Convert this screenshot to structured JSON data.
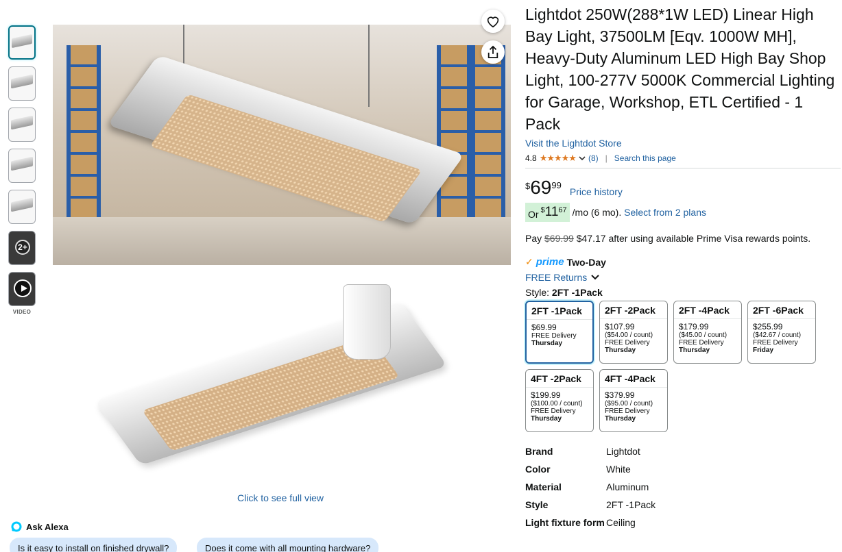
{
  "thumbnails": [
    {
      "kind": "photo",
      "active": true
    },
    {
      "kind": "photo"
    },
    {
      "kind": "photo"
    },
    {
      "kind": "photo"
    },
    {
      "kind": "photo"
    },
    {
      "kind": "more",
      "badge": "2+"
    },
    {
      "kind": "video"
    }
  ],
  "video_label": "VIDEO",
  "image_actions": {
    "wishlist_icon": "heart-icon",
    "share_icon": "share-icon"
  },
  "full_view_link": "Click to see full view",
  "ask_alexa": {
    "label": "Ask Alexa",
    "questions": [
      "Is it easy to install on finished drywall?",
      "Does it come with all mounting hardware?"
    ]
  },
  "product": {
    "title": "Lightdot 250W(288*1W LED) Linear High Bay Light, 37500LM [Eqv. 1000W MH], Heavy-Duty Aluminum LED High Bay Shop Light, 100-277V 5000K Commercial Lighting for Garage, Workshop, ETL Certified - 1 Pack",
    "store_link": "Visit the Lightdot Store",
    "rating": "4.8",
    "stars": "★★★★★",
    "review_count": "(8)",
    "search_page": "Search this page"
  },
  "price": {
    "currency": "$",
    "whole": "69",
    "fraction": "99",
    "history_link": "Price history",
    "monthly": {
      "or": "Or",
      "currency": "$",
      "whole": "11",
      "fraction": "67",
      "term": "/mo (6 mo).",
      "plans_link": "Select from 2 plans"
    },
    "pay_prefix": "Pay",
    "pay_original": "$69.99",
    "pay_rest": "$47.17 after using available Prime Visa rewards points."
  },
  "delivery": {
    "prime": "prime",
    "two_day": "Two-Day",
    "returns": "FREE Returns"
  },
  "style": {
    "label": "Style:",
    "selected": "2FT -1Pack",
    "options": [
      {
        "name": "2FT -1Pack",
        "price": "$69.99",
        "per": "",
        "delivery": "FREE Delivery",
        "day": "Thursday",
        "selected": true
      },
      {
        "name": "2FT -2Pack",
        "price": "$107.99",
        "per": "($54.00 / count)",
        "delivery": "FREE Delivery",
        "day": "Thursday"
      },
      {
        "name": "2FT -4Pack",
        "price": "$179.99",
        "per": "($45.00 / count)",
        "delivery": "FREE Delivery",
        "day": "Thursday"
      },
      {
        "name": "2FT -6Pack",
        "price": "$255.99",
        "per": "($42.67 / count)",
        "delivery": "FREE Delivery",
        "day": "Friday"
      },
      {
        "name": "4FT -2Pack",
        "price": "$199.99",
        "per": "($100.00 / count)",
        "delivery": "FREE Delivery",
        "day": "Thursday"
      },
      {
        "name": "4FT -4Pack",
        "price": "$379.99",
        "per": "($95.00 / count)",
        "delivery": "FREE Delivery",
        "day": "Thursday"
      }
    ]
  },
  "specs": [
    {
      "key": "Brand",
      "value": "Lightdot"
    },
    {
      "key": "Color",
      "value": "White"
    },
    {
      "key": "Material",
      "value": "Aluminum"
    },
    {
      "key": "Style",
      "value": "2FT -1Pack"
    },
    {
      "key": "Light fixture form",
      "value": "Ceiling"
    }
  ],
  "colors": {
    "link": "#2162a1",
    "stars": "#de7921",
    "monthly_bg": "#d2f1d7",
    "prime": "#1399ff",
    "alexa_chip": "#d7e8fb"
  }
}
